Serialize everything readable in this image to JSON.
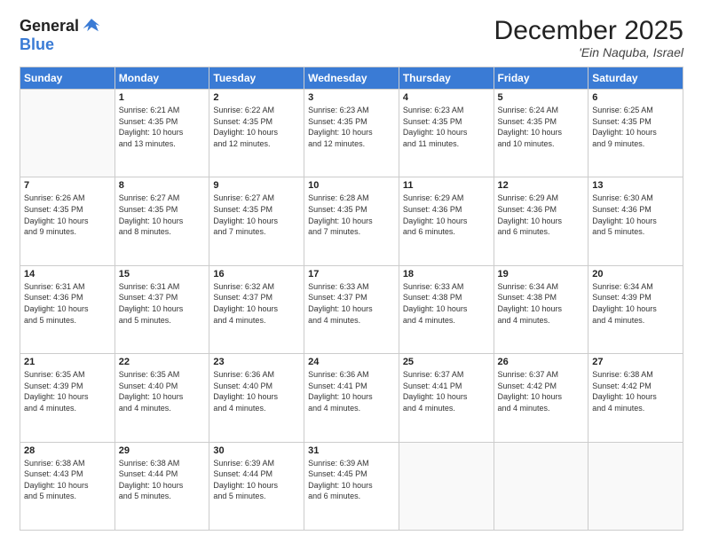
{
  "logo": {
    "general": "General",
    "blue": "Blue"
  },
  "header": {
    "month": "December 2025",
    "location": "'Ein Naquba, Israel"
  },
  "days_of_week": [
    "Sunday",
    "Monday",
    "Tuesday",
    "Wednesday",
    "Thursday",
    "Friday",
    "Saturday"
  ],
  "weeks": [
    [
      {
        "day": "",
        "info": ""
      },
      {
        "day": "1",
        "info": "Sunrise: 6:21 AM\nSunset: 4:35 PM\nDaylight: 10 hours\nand 13 minutes."
      },
      {
        "day": "2",
        "info": "Sunrise: 6:22 AM\nSunset: 4:35 PM\nDaylight: 10 hours\nand 12 minutes."
      },
      {
        "day": "3",
        "info": "Sunrise: 6:23 AM\nSunset: 4:35 PM\nDaylight: 10 hours\nand 12 minutes."
      },
      {
        "day": "4",
        "info": "Sunrise: 6:23 AM\nSunset: 4:35 PM\nDaylight: 10 hours\nand 11 minutes."
      },
      {
        "day": "5",
        "info": "Sunrise: 6:24 AM\nSunset: 4:35 PM\nDaylight: 10 hours\nand 10 minutes."
      },
      {
        "day": "6",
        "info": "Sunrise: 6:25 AM\nSunset: 4:35 PM\nDaylight: 10 hours\nand 9 minutes."
      }
    ],
    [
      {
        "day": "7",
        "info": "Sunrise: 6:26 AM\nSunset: 4:35 PM\nDaylight: 10 hours\nand 9 minutes."
      },
      {
        "day": "8",
        "info": "Sunrise: 6:27 AM\nSunset: 4:35 PM\nDaylight: 10 hours\nand 8 minutes."
      },
      {
        "day": "9",
        "info": "Sunrise: 6:27 AM\nSunset: 4:35 PM\nDaylight: 10 hours\nand 7 minutes."
      },
      {
        "day": "10",
        "info": "Sunrise: 6:28 AM\nSunset: 4:35 PM\nDaylight: 10 hours\nand 7 minutes."
      },
      {
        "day": "11",
        "info": "Sunrise: 6:29 AM\nSunset: 4:36 PM\nDaylight: 10 hours\nand 6 minutes."
      },
      {
        "day": "12",
        "info": "Sunrise: 6:29 AM\nSunset: 4:36 PM\nDaylight: 10 hours\nand 6 minutes."
      },
      {
        "day": "13",
        "info": "Sunrise: 6:30 AM\nSunset: 4:36 PM\nDaylight: 10 hours\nand 5 minutes."
      }
    ],
    [
      {
        "day": "14",
        "info": "Sunrise: 6:31 AM\nSunset: 4:36 PM\nDaylight: 10 hours\nand 5 minutes."
      },
      {
        "day": "15",
        "info": "Sunrise: 6:31 AM\nSunset: 4:37 PM\nDaylight: 10 hours\nand 5 minutes."
      },
      {
        "day": "16",
        "info": "Sunrise: 6:32 AM\nSunset: 4:37 PM\nDaylight: 10 hours\nand 4 minutes."
      },
      {
        "day": "17",
        "info": "Sunrise: 6:33 AM\nSunset: 4:37 PM\nDaylight: 10 hours\nand 4 minutes."
      },
      {
        "day": "18",
        "info": "Sunrise: 6:33 AM\nSunset: 4:38 PM\nDaylight: 10 hours\nand 4 minutes."
      },
      {
        "day": "19",
        "info": "Sunrise: 6:34 AM\nSunset: 4:38 PM\nDaylight: 10 hours\nand 4 minutes."
      },
      {
        "day": "20",
        "info": "Sunrise: 6:34 AM\nSunset: 4:39 PM\nDaylight: 10 hours\nand 4 minutes."
      }
    ],
    [
      {
        "day": "21",
        "info": "Sunrise: 6:35 AM\nSunset: 4:39 PM\nDaylight: 10 hours\nand 4 minutes."
      },
      {
        "day": "22",
        "info": "Sunrise: 6:35 AM\nSunset: 4:40 PM\nDaylight: 10 hours\nand 4 minutes."
      },
      {
        "day": "23",
        "info": "Sunrise: 6:36 AM\nSunset: 4:40 PM\nDaylight: 10 hours\nand 4 minutes."
      },
      {
        "day": "24",
        "info": "Sunrise: 6:36 AM\nSunset: 4:41 PM\nDaylight: 10 hours\nand 4 minutes."
      },
      {
        "day": "25",
        "info": "Sunrise: 6:37 AM\nSunset: 4:41 PM\nDaylight: 10 hours\nand 4 minutes."
      },
      {
        "day": "26",
        "info": "Sunrise: 6:37 AM\nSunset: 4:42 PM\nDaylight: 10 hours\nand 4 minutes."
      },
      {
        "day": "27",
        "info": "Sunrise: 6:38 AM\nSunset: 4:42 PM\nDaylight: 10 hours\nand 4 minutes."
      }
    ],
    [
      {
        "day": "28",
        "info": "Sunrise: 6:38 AM\nSunset: 4:43 PM\nDaylight: 10 hours\nand 5 minutes."
      },
      {
        "day": "29",
        "info": "Sunrise: 6:38 AM\nSunset: 4:44 PM\nDaylight: 10 hours\nand 5 minutes."
      },
      {
        "day": "30",
        "info": "Sunrise: 6:39 AM\nSunset: 4:44 PM\nDaylight: 10 hours\nand 5 minutes."
      },
      {
        "day": "31",
        "info": "Sunrise: 6:39 AM\nSunset: 4:45 PM\nDaylight: 10 hours\nand 6 minutes."
      },
      {
        "day": "",
        "info": ""
      },
      {
        "day": "",
        "info": ""
      },
      {
        "day": "",
        "info": ""
      }
    ]
  ]
}
